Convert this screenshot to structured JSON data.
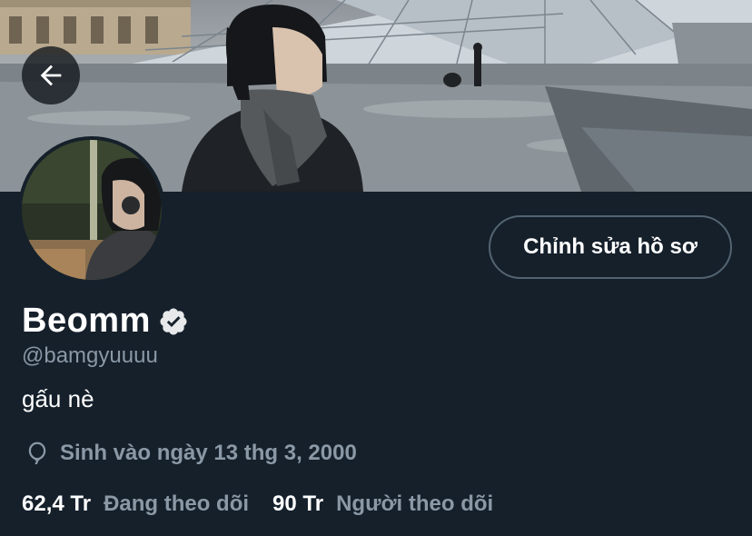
{
  "header": {
    "back_icon": "arrow-left-icon"
  },
  "profile": {
    "display_name": "Beomm",
    "verified_icon": "verified-badge-icon",
    "handle": "@bamgyuuuu",
    "bio": "gấu nè",
    "birthday_icon": "balloon-icon",
    "birthday": "Sinh vào ngày 13 thg 3, 2000",
    "following_count": "62,4 Tr",
    "following_label": "Đang theo dõi",
    "followers_count": "90 Tr",
    "followers_label": "Người theo dõi",
    "edit_button_label": "Chỉnh sửa hồ sơ"
  },
  "colors": {
    "background": "#15202b",
    "secondary_text": "#8b98a5",
    "border": "#536471"
  }
}
